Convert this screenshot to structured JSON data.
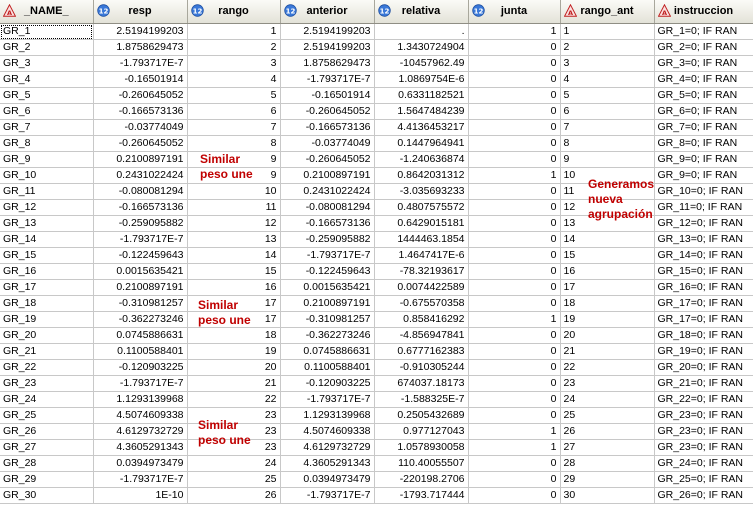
{
  "columns": [
    {
      "key": "name",
      "label": "_NAME_",
      "icon": "triangle-text-icon",
      "align": "txt",
      "width": 93
    },
    {
      "key": "resp",
      "label": "resp",
      "icon": "circle-numeric-icon",
      "align": "num",
      "width": 94
    },
    {
      "key": "rango",
      "label": "rango",
      "icon": "circle-numeric-icon",
      "align": "num",
      "width": 93
    },
    {
      "key": "anterior",
      "label": "anterior",
      "icon": "circle-numeric-icon",
      "align": "num",
      "width": 94
    },
    {
      "key": "relativa",
      "label": "relativa",
      "icon": "circle-numeric-icon",
      "align": "num",
      "width": 94
    },
    {
      "key": "junta",
      "label": "junta",
      "icon": "circle-numeric-icon",
      "align": "num",
      "width": 92
    },
    {
      "key": "rango_ant",
      "label": "rango_ant",
      "icon": "triangle-text-icon",
      "align": "txt",
      "width": 94
    },
    {
      "key": "instruccion",
      "label": "instruccion",
      "icon": "triangle-text-icon",
      "align": "txt",
      "width": 99
    }
  ],
  "rows": [
    [
      "GR_1",
      "2.5194199203",
      "1",
      "2.5194199203",
      ".",
      "1",
      "1",
      "GR_1=0; IF RAN"
    ],
    [
      "GR_2",
      "1.8758629473",
      "2",
      "2.5194199203",
      "1.3430724904",
      "0",
      "2",
      "GR_2=0; IF RAN"
    ],
    [
      "GR_3",
      "-1.793717E-7",
      "3",
      "1.8758629473",
      "-10457962.49",
      "0",
      "3",
      "GR_3=0; IF RAN"
    ],
    [
      "GR_4",
      "-0.16501914",
      "4",
      "-1.793717E-7",
      "1.0869754E-6",
      "0",
      "4",
      "GR_4=0; IF RAN"
    ],
    [
      "GR_5",
      "-0.260645052",
      "5",
      "-0.16501914",
      "0.6331182521",
      "0",
      "5",
      "GR_5=0; IF RAN"
    ],
    [
      "GR_6",
      "-0.166573136",
      "6",
      "-0.260645052",
      "1.5647484239",
      "0",
      "6",
      "GR_6=0; IF RAN"
    ],
    [
      "GR_7",
      "-0.03774049",
      "7",
      "-0.166573136",
      "4.4136453217",
      "0",
      "7",
      "GR_7=0; IF RAN"
    ],
    [
      "GR_8",
      "-0.260645052",
      "8",
      "-0.03774049",
      "0.1447964941",
      "0",
      "8",
      "GR_8=0; IF RAN"
    ],
    [
      "GR_9",
      "0.2100897191",
      "9",
      "-0.260645052",
      "-1.240636874",
      "0",
      "9",
      "GR_9=0; IF RAN"
    ],
    [
      "GR_10",
      "0.2431022424",
      "9",
      "0.2100897191",
      "0.8642031312",
      "1",
      "10",
      "GR_9=0; IF RAN"
    ],
    [
      "GR_11",
      "-0.080081294",
      "10",
      "0.2431022424",
      "-3.035693233",
      "0",
      "11",
      "GR_10=0; IF RAN"
    ],
    [
      "GR_12",
      "-0.166573136",
      "11",
      "-0.080081294",
      "0.4807575572",
      "0",
      "12",
      "GR_11=0; IF RAN"
    ],
    [
      "GR_13",
      "-0.259095882",
      "12",
      "-0.166573136",
      "0.6429015181",
      "0",
      "13",
      "GR_12=0; IF RAN"
    ],
    [
      "GR_14",
      "-1.793717E-7",
      "13",
      "-0.259095882",
      "1444463.1854",
      "0",
      "14",
      "GR_13=0; IF RAN"
    ],
    [
      "GR_15",
      "-0.122459643",
      "14",
      "-1.793717E-7",
      "1.4647417E-6",
      "0",
      "15",
      "GR_14=0; IF RAN"
    ],
    [
      "GR_16",
      "0.0015635421",
      "15",
      "-0.122459643",
      "-78.32193617",
      "0",
      "16",
      "GR_15=0; IF RAN"
    ],
    [
      "GR_17",
      "0.2100897191",
      "16",
      "0.0015635421",
      "0.0074422589",
      "0",
      "17",
      "GR_16=0; IF RAN"
    ],
    [
      "GR_18",
      "-0.310981257",
      "17",
      "0.2100897191",
      "-0.675570358",
      "0",
      "18",
      "GR_17=0; IF RAN"
    ],
    [
      "GR_19",
      "-0.362273246",
      "17",
      "-0.310981257",
      "0.858416292",
      "1",
      "19",
      "GR_17=0; IF RAN"
    ],
    [
      "GR_20",
      "0.0745886631",
      "18",
      "-0.362273246",
      "-4.856947841",
      "0",
      "20",
      "GR_18=0; IF RAN"
    ],
    [
      "GR_21",
      "0.1100588401",
      "19",
      "0.0745886631",
      "0.6777162383",
      "0",
      "21",
      "GR_19=0; IF RAN"
    ],
    [
      "GR_22",
      "-0.120903225",
      "20",
      "0.1100588401",
      "-0.910305244",
      "0",
      "22",
      "GR_20=0; IF RAN"
    ],
    [
      "GR_23",
      "-1.793717E-7",
      "21",
      "-0.120903225",
      "674037.18173",
      "0",
      "23",
      "GR_21=0; IF RAN"
    ],
    [
      "GR_24",
      "1.1293139968",
      "22",
      "-1.793717E-7",
      "-1.588325E-7",
      "0",
      "24",
      "GR_22=0; IF RAN"
    ],
    [
      "GR_25",
      "4.5074609338",
      "23",
      "1.1293139968",
      "0.2505432689",
      "0",
      "25",
      "GR_23=0; IF RAN"
    ],
    [
      "GR_26",
      "4.6129732729",
      "23",
      "4.5074609338",
      "0.977127043",
      "1",
      "26",
      "GR_23=0; IF RAN"
    ],
    [
      "GR_27",
      "4.3605291343",
      "23",
      "4.6129732729",
      "1.0578930058",
      "1",
      "27",
      "GR_23=0; IF RAN"
    ],
    [
      "GR_28",
      "0.0394973479",
      "24",
      "4.3605291343",
      "110.40055507",
      "0",
      "28",
      "GR_24=0; IF RAN"
    ],
    [
      "GR_29",
      "-1.793717E-7",
      "25",
      "0.0394973479",
      "-220198.2706",
      "0",
      "29",
      "GR_25=0; IF RAN"
    ],
    [
      "GR_30",
      "1E-10",
      "26",
      "-1.793717E-7",
      "-1793.717444",
      "0",
      "30",
      "GR_26=0; IF RAN"
    ]
  ],
  "annotations": [
    {
      "name": "annotation-similar-1",
      "text": "Similar\npeso une"
    },
    {
      "name": "annotation-similar-2",
      "text": "Similar\npeso une"
    },
    {
      "name": "annotation-similar-3",
      "text": "Similar\npeso une"
    },
    {
      "name": "annotation-generamos",
      "text": "Generamos\nnueva\nagrupación"
    }
  ],
  "colors": {
    "annotation": "#c00000",
    "header_bg": "#e3e2d8",
    "grid_line": "#c8c8c8"
  }
}
